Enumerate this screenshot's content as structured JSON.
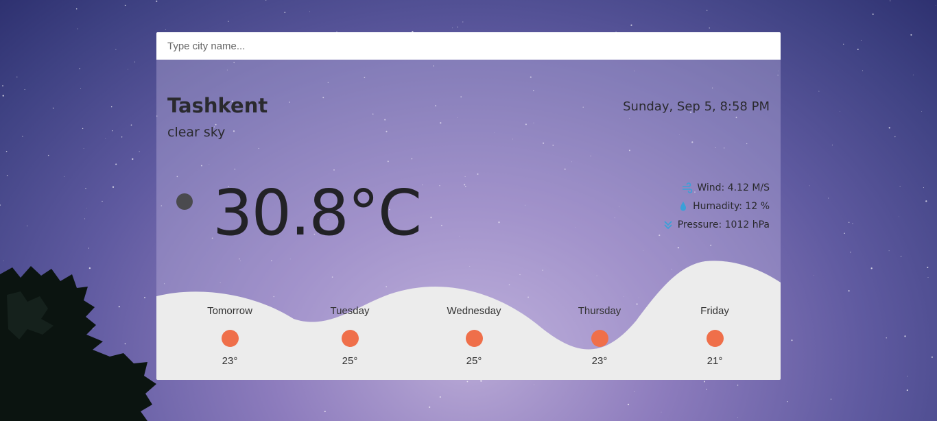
{
  "search": {
    "placeholder": "Type city name..."
  },
  "current": {
    "city": "Tashkent",
    "description": "clear sky",
    "datetime": "Sunday, Sep 5, 8:58 PM",
    "temperature": "30.8°C",
    "icon": "moon-clear-icon"
  },
  "details": {
    "wind": "Wind: 4.12 M/S",
    "humidity": "Humadity: 12 %",
    "pressure": "Pressure: 1012 hPa"
  },
  "forecast": [
    {
      "day": "Tomorrow",
      "temp": "23°",
      "icon": "sun-icon"
    },
    {
      "day": "Tuesday",
      "temp": "25°",
      "icon": "sun-icon"
    },
    {
      "day": "Wednesday",
      "temp": "25°",
      "icon": "sun-icon"
    },
    {
      "day": "Thursday",
      "temp": "23°",
      "icon": "sun-icon"
    },
    {
      "day": "Friday",
      "temp": "21°",
      "icon": "sun-icon"
    }
  ],
  "colors": {
    "sun": "#ef6f4a",
    "wave": "#ececec",
    "detail_icon": "#3aa0d8",
    "text": "#2a2a2e"
  }
}
